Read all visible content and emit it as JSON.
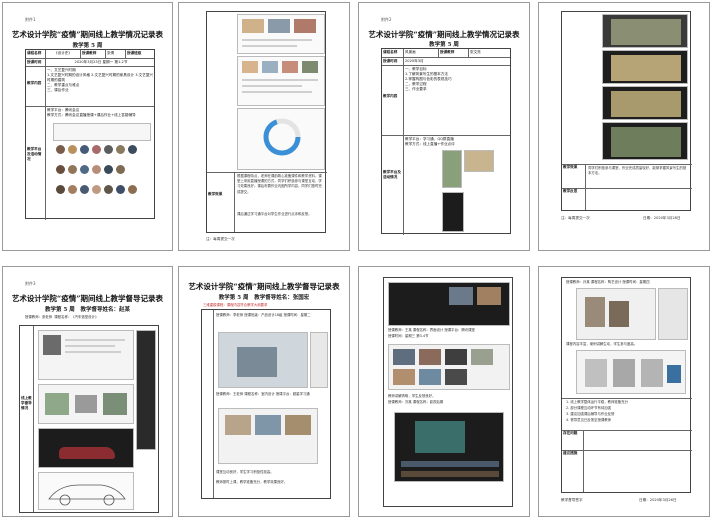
{
  "pages": [
    {
      "tag": "附件1",
      "title": "艺术设计学院“疫情”期间线上教学情况记录表",
      "subtitle": "教学第 5 周",
      "rows": [
        {
          "label": "课程名称",
          "value": "《设计史》",
          "label2": "授课教师",
          "value2": "张倩",
          "label3": "授课班级"
        },
        {
          "label": "授课时间",
          "value": "2020年3月23日 星期一 第1-2节"
        },
        {
          "label": "教学内容",
          "value": "一、文艺复兴时期\n1.文艺复兴时期的设计风格 2.文艺复兴时期的家具设计 3.文艺复兴时期的建筑\n二、教学重点与难点\n三、课后作业"
        },
        {
          "label": "教学平台及活动情况",
          "value": "教学平台：腾讯会议\n教学方式：腾讯会议直播授课+课后作业+线上答疑辅导"
        }
      ]
    },
    {
      "caption": "教学效果",
      "text1": "根据课程特点，老师在课前精心准备课件和教学资料，课堂上采用直播授课的方式，同学们积极参与课堂互动，学习效果良好。课后布置作业巩固所学内容，同学们按时完成提交。",
      "text2": "课后通过学习通平台对学生作业进行点评和反馈。",
      "footer": "注：每周提交一次"
    },
    {
      "tag": "附件2",
      "title": "艺术设计学院“疫情”期间线上教学情况记录表",
      "subtitle": "教学第 5 周",
      "rows": [
        {
          "label": "课程名称",
          "value": "风景画",
          "label2": "授课教师",
          "value2": "张文亮"
        },
        {
          "label": "授课时间",
          "value": "2020年3月"
        },
        {
          "label": "教学内容",
          "value": "一、教学目标\n1.了解风景写生的基本方法\n2.掌握构图与色彩的表现技巧\n二、教学过程\n三、作业要求"
        },
        {
          "label": "教学平台及活动情况",
          "value": "教学平台：学习通、QQ群直播\n教学方式：线上直播+作业点评"
        }
      ]
    },
    {
      "caption1": "教学效果",
      "caption2": "教学反思",
      "text": "同学们积极参与课堂，作业完成质量较好，能够掌握风景写生的基本方法。",
      "footer": "注：每周提交一次",
      "date": "日期：2020年3月28日"
    },
    {
      "tag": "附件3",
      "title": "艺术设计学院“疫情”期间线上教学督导记录表",
      "subtitle": "教学第 5 周",
      "subtitle2": "教学督导姓名：赵某",
      "course": "课程名称：《汽车造型设计》",
      "info": "授课教师：张老师",
      "section": "线上教学督导情况"
    },
    {
      "title": "艺术设计学院“疫情”期间线上教学督导记录表",
      "subtitle": "教学第 5 周",
      "subtitle2": "教学督导姓名：张国宏",
      "note": "三维建模课程：课程内容符合教学大纲要求",
      "text1": "授课教师：李老师  授课班级：产品设计18级  授课时间：星期二",
      "text2": "授课教师：王老师  课程名称：室内设计  授课平台：超星学习通",
      "text3": "课堂互动良好，学生学习积极性较高。",
      "text4": "教师按时上课，教学准备充分，教学效果良好。"
    },
    {
      "text1": "授课教师：王某  课程名称：界面设计  授课平台：腾讯课堂",
      "text2": "授课时间：星期三 第3-4节",
      "text3": "教师讲解清晰，学生反馈良好。",
      "text4": "授课教师：刘某  课程名称：影视后期"
    },
    {
      "text1": "授课教师：孙某  课程名称：陶艺设计  授课时间：星期四",
      "text2": "课程内容丰富，案例讲解生动，学生参与度高。",
      "rows": [
        {
          "n": "1",
          "t": "线上教学整体运行平稳，教师准备充分"
        },
        {
          "n": "2",
          "t": "部分课程互动环节有待加强"
        },
        {
          "n": "3",
          "t": "建议加强课后辅导与作业反馈"
        },
        {
          "n": "4",
          "t": "督导意见已反馈至授课教师"
        }
      ],
      "caption1": "存在问题",
      "caption2": "建议措施",
      "footer": "教学督导签字",
      "date": "日期：2020年3月26日"
    }
  ],
  "colors": {
    "page_border": "#9a9a9a",
    "table_border": "#444444"
  }
}
